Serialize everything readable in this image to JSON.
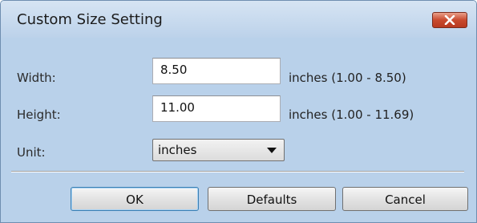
{
  "window": {
    "title": "Custom Size Setting"
  },
  "form": {
    "width_label": "Width:",
    "width_value": "8.50",
    "width_range": "inches (1.00 - 8.50)",
    "height_label": "Height:",
    "height_value": "11.00",
    "height_range": "inches (1.00 - 11.69)",
    "unit_label": "Unit:",
    "unit_value": "inches"
  },
  "buttons": {
    "ok": "OK",
    "defaults": "Defaults",
    "cancel": "Cancel"
  },
  "icons": {
    "close": "close-icon",
    "dropdown": "chevron-down-icon"
  },
  "colors": {
    "title_bar": "#bcd2ea",
    "close_button": "#c94a2e",
    "default_button_border": "#3c7fb1"
  }
}
